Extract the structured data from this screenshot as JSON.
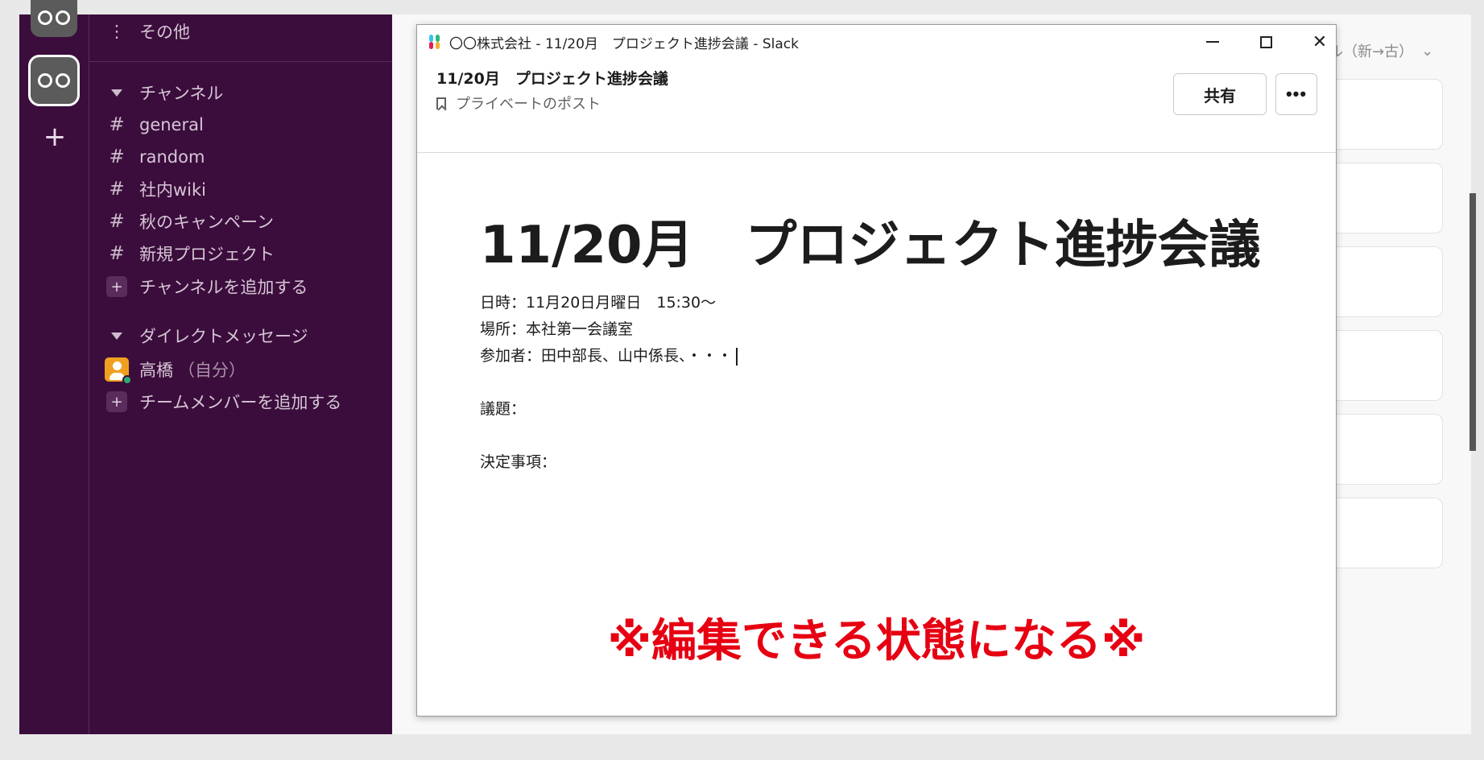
{
  "rail": {
    "workspace_top_icon": "workspace-icon",
    "workspace_active_icon": "workspace-icon",
    "add_label": "+"
  },
  "sidebar": {
    "more_label": "その他",
    "channels_header": "チャンネル",
    "channels": [
      {
        "label": "general"
      },
      {
        "label": "random"
      },
      {
        "label": "社内wiki"
      },
      {
        "label": "秋のキャンペーン"
      },
      {
        "label": "新規プロジェクト"
      }
    ],
    "add_channel_label": "チャンネルを追加する",
    "dm_header": "ダイレクトメッセージ",
    "dm_user": "高橋",
    "dm_user_suffix": "（自分）",
    "add_member_label": "チームメンバーを追加する"
  },
  "background": {
    "sort_label": "ル（新→古）"
  },
  "window": {
    "title": "〇〇株式会社 - 11/20月　プロジェクト進捗会議 - Slack",
    "post_title": "11/20月　プロジェクト進捗会議",
    "post_subtitle": "プライベートのポスト",
    "share_label": "共有",
    "more_label": "•••"
  },
  "document": {
    "title": "11/20月　プロジェクト進捗会議",
    "datetime": "日時：11月20日月曜日　15:30～",
    "place": "場所：本社第一会議室",
    "attendees": "参加者：田中部長、山中係長、・・・",
    "agenda": "議題：",
    "decisions": "決定事項："
  },
  "annotation": "※編集できる状態になる※",
  "colors": {
    "sidebar_bg": "#3b0d3c",
    "annotation_red": "#e60012",
    "presence_green": "#2bac76"
  }
}
